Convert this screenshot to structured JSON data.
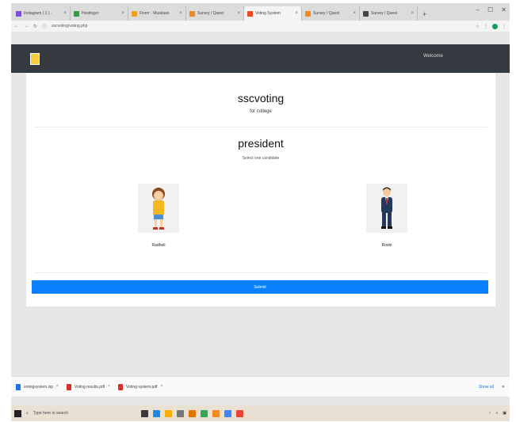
{
  "browser": {
    "tabs": [
      {
        "label": "Instagram ( 1 ) ·",
        "favicon_color": "#7b4fd6",
        "active": false
      },
      {
        "label": "Hostinger",
        "favicon_color": "#2e9f3a",
        "active": false
      },
      {
        "label": "Fiverr · Muskaan",
        "favicon_color": "#f0a020",
        "active": false
      },
      {
        "label": "Survey / Quest",
        "favicon_color": "#f08a20",
        "active": false
      },
      {
        "label": "Voting System",
        "favicon_color": "#f04a20",
        "active": true
      },
      {
        "label": "Survey / Quest",
        "favicon_color": "#f08a20",
        "active": false
      },
      {
        "label": "Survey / Quest",
        "favicon_color": "#444444",
        "active": false
      }
    ],
    "new_tab": "+",
    "address": "sscvoting/voting.php"
  },
  "site": {
    "user": "Welcome"
  },
  "ballot": {
    "title": "sscvoting",
    "subtitle": "for college",
    "position": "president",
    "hint": "Select one candidate",
    "candidates": [
      {
        "name": "Radheli"
      },
      {
        "name": "Roshi"
      }
    ],
    "submit_label": "Submit"
  },
  "downloads": [
    {
      "name": "votingsystem.zip",
      "color": "#1a73e8"
    },
    {
      "name": "Voting results.pdf",
      "color": "#d93025"
    },
    {
      "name": "Voting system.pdf",
      "color": "#d93025"
    }
  ],
  "downloads_show_all": "Show all",
  "taskbar": {
    "search": "Type here to search",
    "app_colors": [
      "#3a3a3a",
      "#1e88e5",
      "#f9ab00",
      "#777777",
      "#e37400",
      "#34a853",
      "#f28b20",
      "#4285f4",
      "#ea4335"
    ]
  }
}
